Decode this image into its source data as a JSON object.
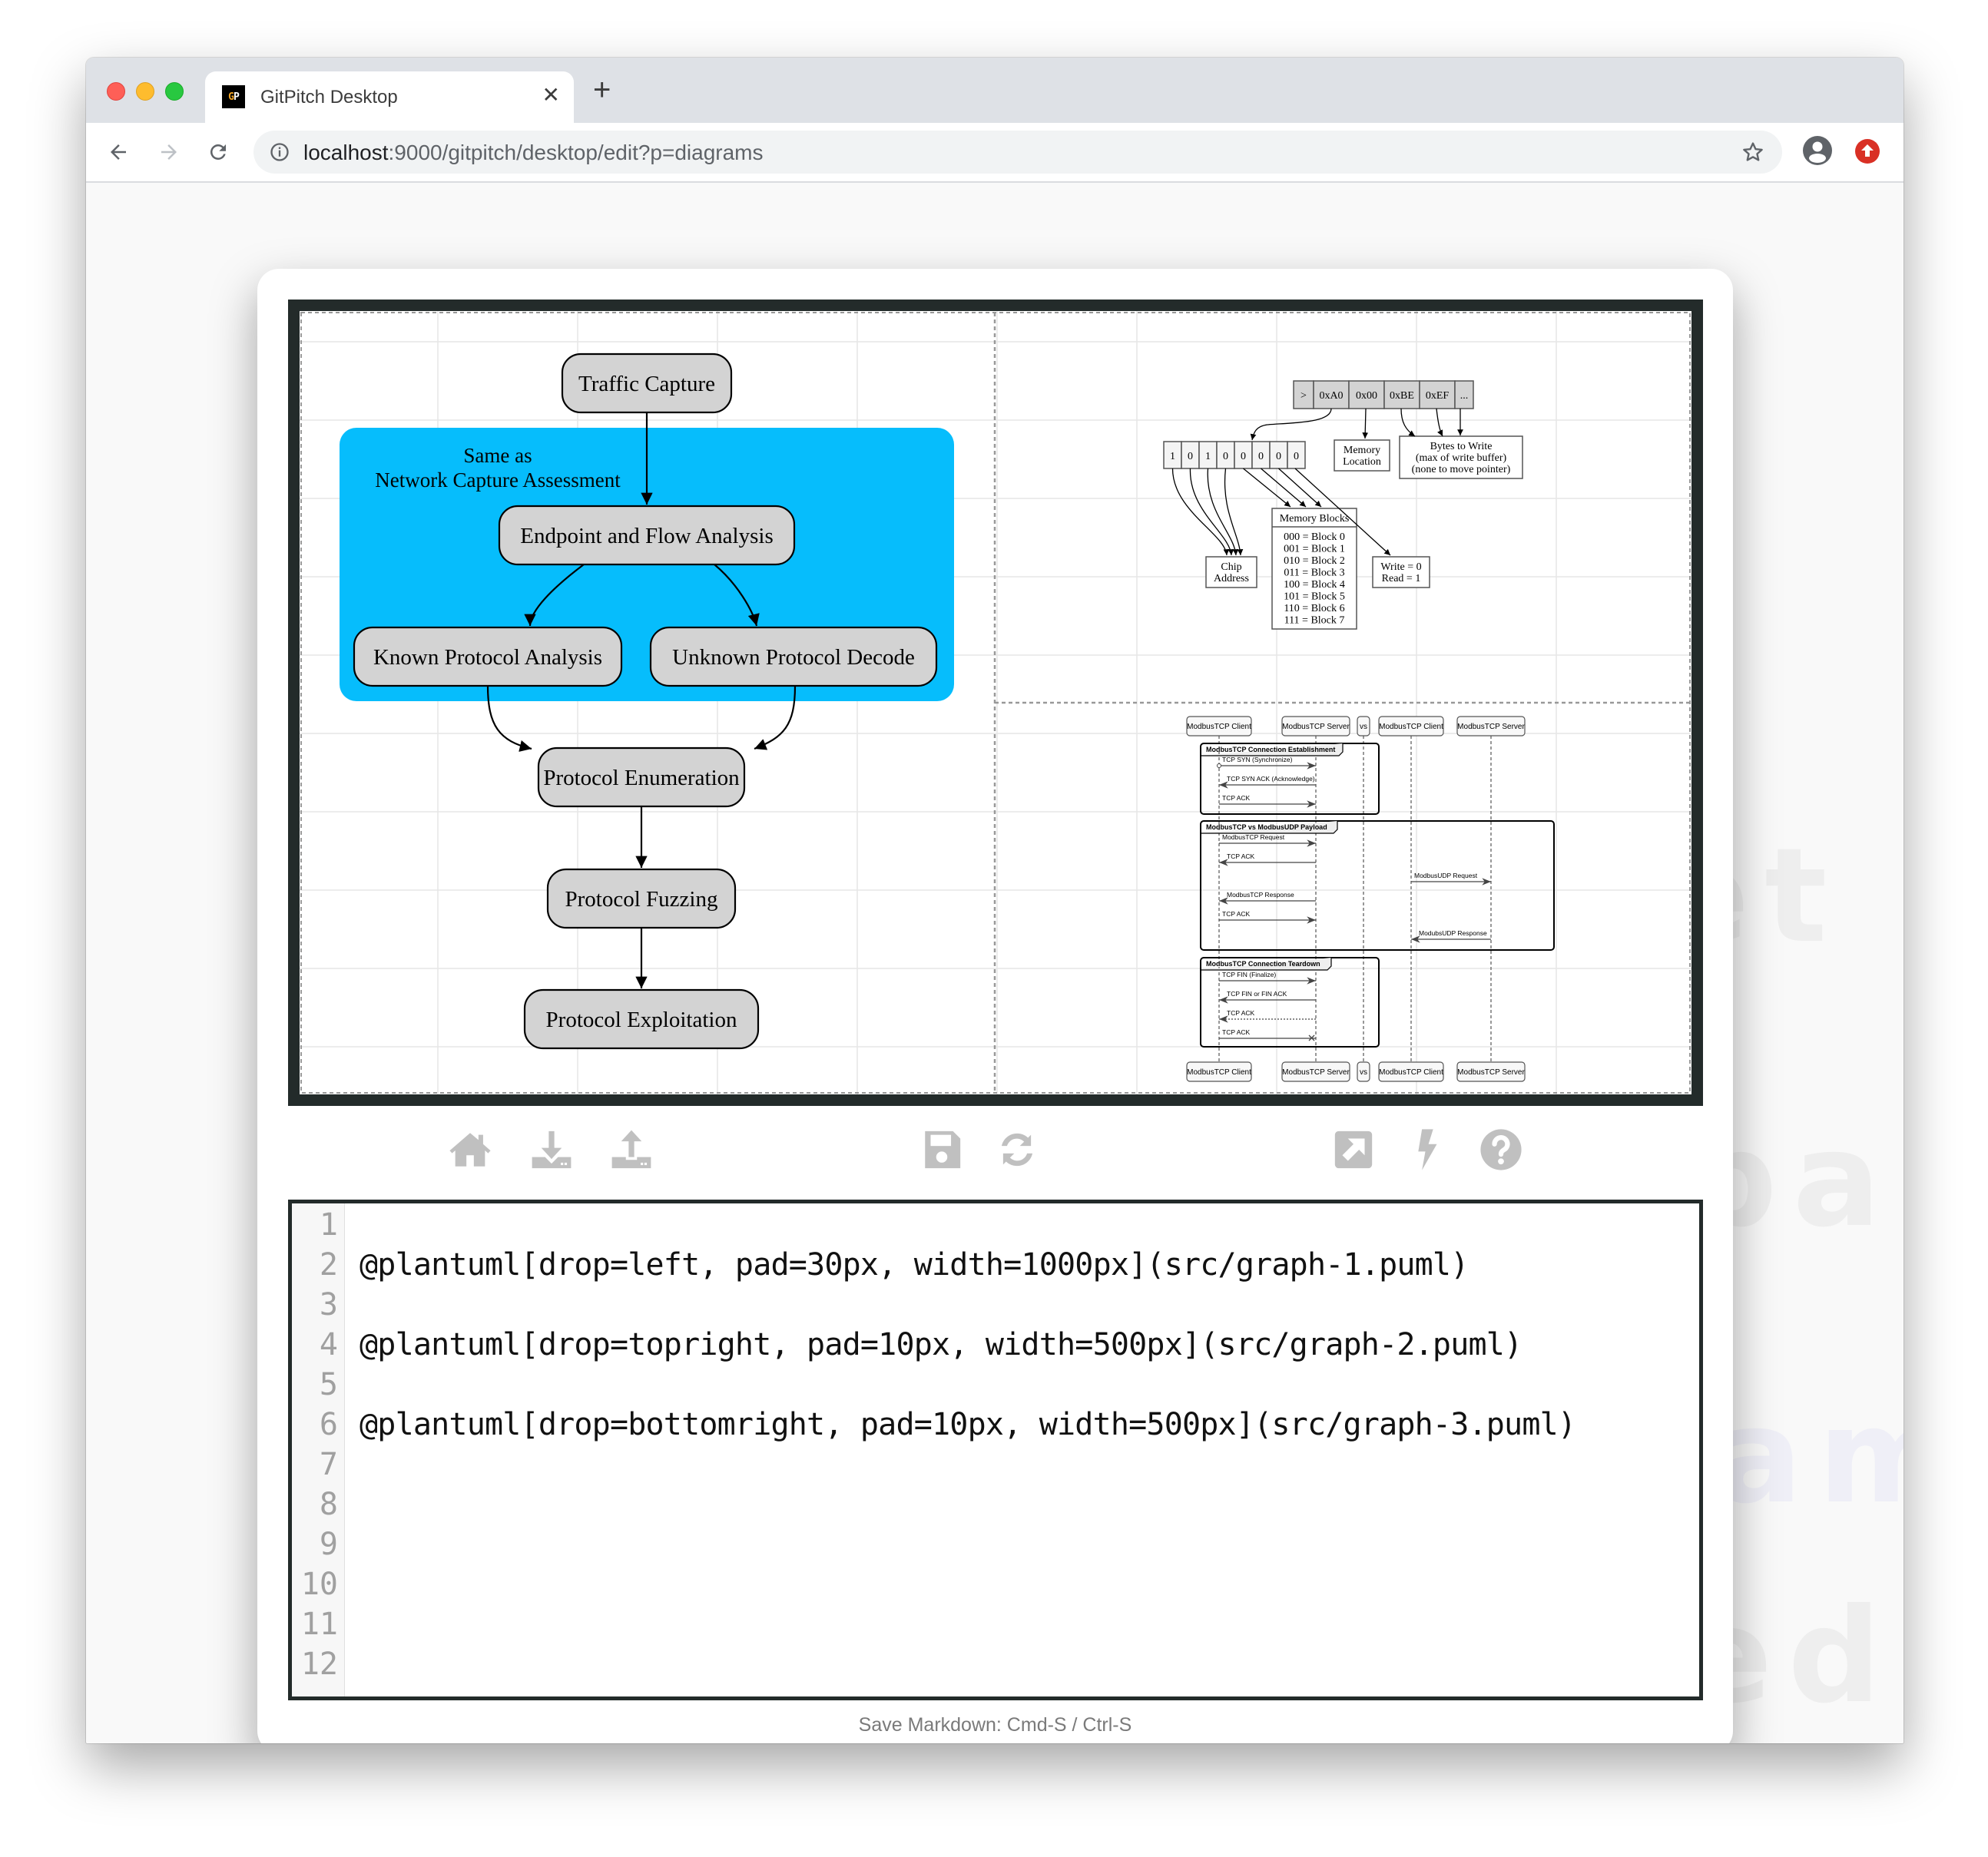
{
  "browser": {
    "tab_title": "GitPitch Desktop",
    "favicon_text_1": "G",
    "favicon_text_2": "P",
    "url_host": "localhost",
    "url_path": ":9000/gitpitch/desktop/edit?p=diagrams",
    "icons": [
      "back-arrow-icon",
      "forward-arrow-icon",
      "reload-icon",
      "info-icon",
      "star-icon",
      "profile-icon",
      "update-icon"
    ]
  },
  "background_watermark": [
    "et",
    "pa",
    "am",
    "ed("
  ],
  "preview": {
    "flowchart": {
      "cluster_label_1": "Same as",
      "cluster_label_2": "Network Capture Assessment",
      "cluster_color": "#06bdfc",
      "nodes": [
        "Traffic Capture",
        "Endpoint and Flow Analysis",
        "Known Protocol Analysis",
        "Unknown Protocol Decode",
        "Protocol Enumeration",
        "Protocol Fuzzing",
        "Protocol Exploitation"
      ]
    },
    "byte_diagram": {
      "top_record": [
        ">",
        "0xA0",
        "0x00",
        "0xBE",
        "0xEF",
        "..."
      ],
      "bits": [
        "1",
        "0",
        "1",
        "0",
        "0",
        "0",
        "0",
        "0"
      ],
      "memory_location": [
        "Memory",
        "Location"
      ],
      "bytes_to_write": [
        "Bytes to Write",
        "(max of write buffer)",
        "(none to move pointer)"
      ],
      "chip_address": [
        "Chip",
        "Address"
      ],
      "memory_blocks_title": "Memory Blocks",
      "memory_blocks": [
        "000 = Block 0",
        "001 = Block 1",
        "010 = Block 2",
        "011 = Block 3",
        "100 = Block 4",
        "101 = Block 5",
        "110 = Block 6",
        "111 = Block 7"
      ],
      "rw": [
        "Write = 0",
        "Read = 1"
      ]
    },
    "sequence": {
      "participants": [
        "ModbusTCP Client",
        "ModbusTCP Server",
        "vs",
        "ModbusTCP Client",
        "ModbusTCP Server"
      ],
      "groups": [
        {
          "title": "ModbusTCP Connection Establishment",
          "messages": [
            {
              "label": "TCP SYN (Synchronize)",
              "from": 0,
              "to": 1,
              "style": "solid",
              "start": "circle"
            },
            {
              "label": "TCP SYN ACK (Acknowledge)",
              "from": 1,
              "to": 0,
              "style": "solid"
            },
            {
              "label": "TCP ACK",
              "from": 0,
              "to": 1,
              "style": "solid"
            }
          ]
        },
        {
          "title": "ModbusTCP vs ModbusUDP Payload",
          "messages": [
            {
              "label": "ModbusTCP Request",
              "from": 0,
              "to": 1,
              "style": "solid"
            },
            {
              "label": "TCP ACK",
              "from": 1,
              "to": 0,
              "style": "solid"
            },
            {
              "label": "ModbusUDP Request",
              "from": 3,
              "to": 4,
              "style": "solid"
            },
            {
              "label": "ModbusTCP Response",
              "from": 1,
              "to": 0,
              "style": "solid"
            },
            {
              "label": "TCP ACK",
              "from": 0,
              "to": 1,
              "style": "solid"
            },
            {
              "label": "ModubsUDP Response",
              "from": 4,
              "to": 3,
              "style": "solid"
            }
          ]
        },
        {
          "title": "ModbusTCP Connection Teardown",
          "messages": [
            {
              "label": "TCP FIN (Finalize)",
              "from": 0,
              "to": 1,
              "style": "solid"
            },
            {
              "label": "TCP FIN or FIN ACK",
              "from": 1,
              "to": 0,
              "style": "solid"
            },
            {
              "label": "TCP ACK",
              "from": 1,
              "to": 0,
              "style": "dotted"
            },
            {
              "label": "TCP ACK",
              "from": 0,
              "to": 1,
              "style": "solid",
              "end": "cross"
            }
          ]
        }
      ]
    }
  },
  "toolbar": {
    "left": [
      "home-icon",
      "download-icon",
      "upload-icon"
    ],
    "middle": [
      "save-icon",
      "refresh-icon"
    ],
    "right": [
      "external-link-icon",
      "lightning-icon",
      "help-icon"
    ],
    "icon_color": "#c0c0c0"
  },
  "editor": {
    "line_numbers": [
      "1",
      "2",
      "3",
      "4",
      "5",
      "6",
      "7",
      "8",
      "9",
      "10",
      "11",
      "12"
    ],
    "lines": [
      "",
      "@plantuml[drop=left, pad=30px, width=1000px](src/graph-1.puml)",
      "",
      "@plantuml[drop=topright, pad=10px, width=500px](src/graph-2.puml)",
      "",
      "@plantuml[drop=bottomright, pad=10px, width=500px](src/graph-3.puml)",
      "",
      "",
      "",
      "",
      "",
      ""
    ]
  },
  "footer": {
    "hint": "Save Markdown: Cmd-S / Ctrl-S"
  }
}
